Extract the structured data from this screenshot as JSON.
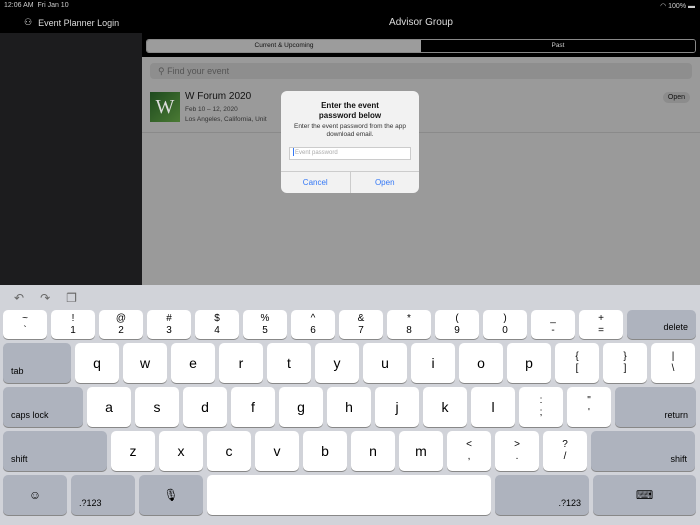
{
  "status": {
    "time": "12:06 AM",
    "date": "Fri Jan 10",
    "battery": "100%"
  },
  "sidebar": {
    "login_label": "Event Planner Login"
  },
  "header": {
    "title": "Advisor Group"
  },
  "tabs": {
    "current": "Current & Upcoming",
    "past": "Past"
  },
  "search": {
    "placeholder": "Find your event"
  },
  "event": {
    "logo": "W",
    "title": "W Forum 2020",
    "date": "Feb 10 – 12, 2020",
    "location": "Los Angeles, California, Unit",
    "action": "Open"
  },
  "dialog": {
    "title": "Enter the event password below",
    "message": "Enter the event password from the app download email.",
    "placeholder": "Event password",
    "cancel": "Cancel",
    "open": "Open"
  },
  "keyboard": {
    "row1": [
      [
        "~",
        "`"
      ],
      [
        "!",
        "1"
      ],
      [
        "@",
        "2"
      ],
      [
        "#",
        "3"
      ],
      [
        "$",
        "4"
      ],
      [
        "%",
        "5"
      ],
      [
        "^",
        "6"
      ],
      [
        "&",
        "7"
      ],
      [
        "*",
        "8"
      ],
      [
        "(",
        "9"
      ],
      [
        ")",
        "0"
      ],
      [
        "_",
        "-"
      ],
      [
        "+",
        "="
      ]
    ],
    "delete": "delete",
    "tab": "tab",
    "row2": [
      "q",
      "w",
      "e",
      "r",
      "t",
      "y",
      "u",
      "i",
      "o",
      "p"
    ],
    "row2_sym": [
      [
        "{",
        "["
      ],
      [
        "}",
        "]"
      ],
      [
        "|",
        "\\"
      ]
    ],
    "caps": "caps lock",
    "row3": [
      "a",
      "s",
      "d",
      "f",
      "g",
      "h",
      "j",
      "k",
      "l"
    ],
    "row3_sym": [
      [
        ":",
        ";"
      ],
      [
        "\"",
        "'"
      ]
    ],
    "return": "return",
    "shift": "shift",
    "row4": [
      "z",
      "x",
      "c",
      "v",
      "b",
      "n",
      "m"
    ],
    "row4_sym": [
      [
        "<",
        ","
      ],
      [
        ">",
        "."
      ],
      [
        "?",
        "/"
      ]
    ],
    "numbers": ".?123"
  }
}
